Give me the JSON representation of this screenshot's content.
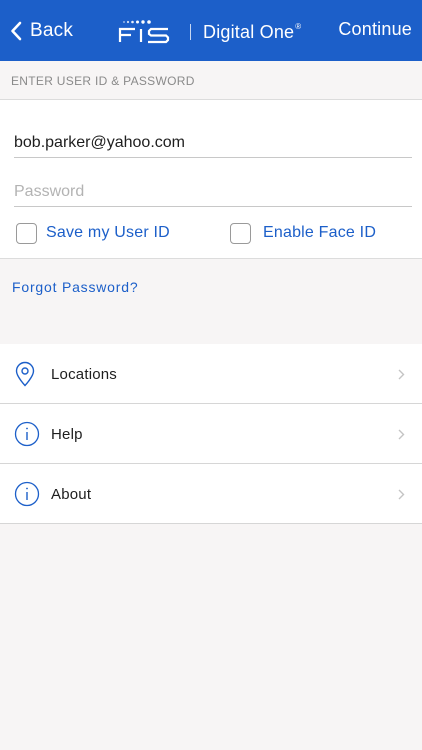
{
  "header": {
    "back_label": "Back",
    "logo_brand": "FIS",
    "logo_product": "Digital One",
    "logo_mark": "®",
    "continue_label": "Continue"
  },
  "section": {
    "title": "ENTER USER ID & PASSWORD"
  },
  "form": {
    "user_id_value": "bob.parker@yahoo.com",
    "password_placeholder": "Password",
    "save_user_id_label": "Save my User ID",
    "save_user_id_checked": false,
    "enable_face_id_label": "Enable Face ID",
    "enable_face_id_checked": false,
    "forgot_password_label": "Forgot Password?"
  },
  "menu": {
    "items": [
      {
        "label": "Locations",
        "icon": "location-pin-icon"
      },
      {
        "label": "Help",
        "icon": "info-icon"
      },
      {
        "label": "About",
        "icon": "info-icon"
      }
    ]
  },
  "colors": {
    "brand_blue": "#1c5fc9",
    "background": "#f7f5f5",
    "text": "#1e1e1e",
    "muted": "#8a8a8a"
  }
}
